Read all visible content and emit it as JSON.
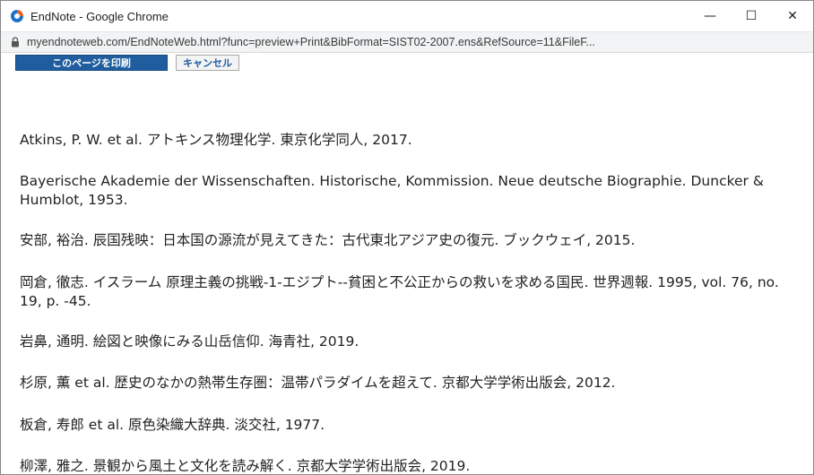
{
  "window": {
    "title": "EndNote - Google Chrome",
    "controls": {
      "minimize": "—",
      "maximize": "☐",
      "close": "✕"
    }
  },
  "address_bar": {
    "url": "myendnoteweb.com/EndNoteWeb.html?func=preview+Print&BibFormat=SIST02-2007.ens&RefSource=11&FileF..."
  },
  "toolbar": {
    "print_label": "このページを印刷",
    "cancel_label": "キャンセル"
  },
  "references": [
    "Atkins, P. W. et al. アトキンス物理化学. 東京化学同人, 2017.",
    "Bayerische Akademie der Wissenschaften. Historische, Kommission. Neue deutsche Biographie. Duncker & Humblot, 1953.",
    "安部, 裕治. 辰国残映：日本国の源流が見えてきた：古代東北アジア史の復元. ブックウェイ, 2015.",
    "岡倉, 徹志. イスラーム 原理主義の挑戦-1-エジプト--貧困と不公正からの救いを求める国民. 世界週報. 1995, vol. 76, no. 19, p. -45.",
    "岩鼻, 通明. 絵図と映像にみる山岳信仰. 海青社, 2019.",
    "杉原, 薫 et al. 歴史のなかの熱帯生存圏：温帯パラダイムを超えて. 京都大学学術出版会, 2012.",
    "板倉, 寿郎 et al. 原色染織大辞典. 淡交社, 1977.",
    "柳澤, 雅之. 景観から風土と文化を読み解く. 京都大学学術出版会, 2019."
  ]
}
